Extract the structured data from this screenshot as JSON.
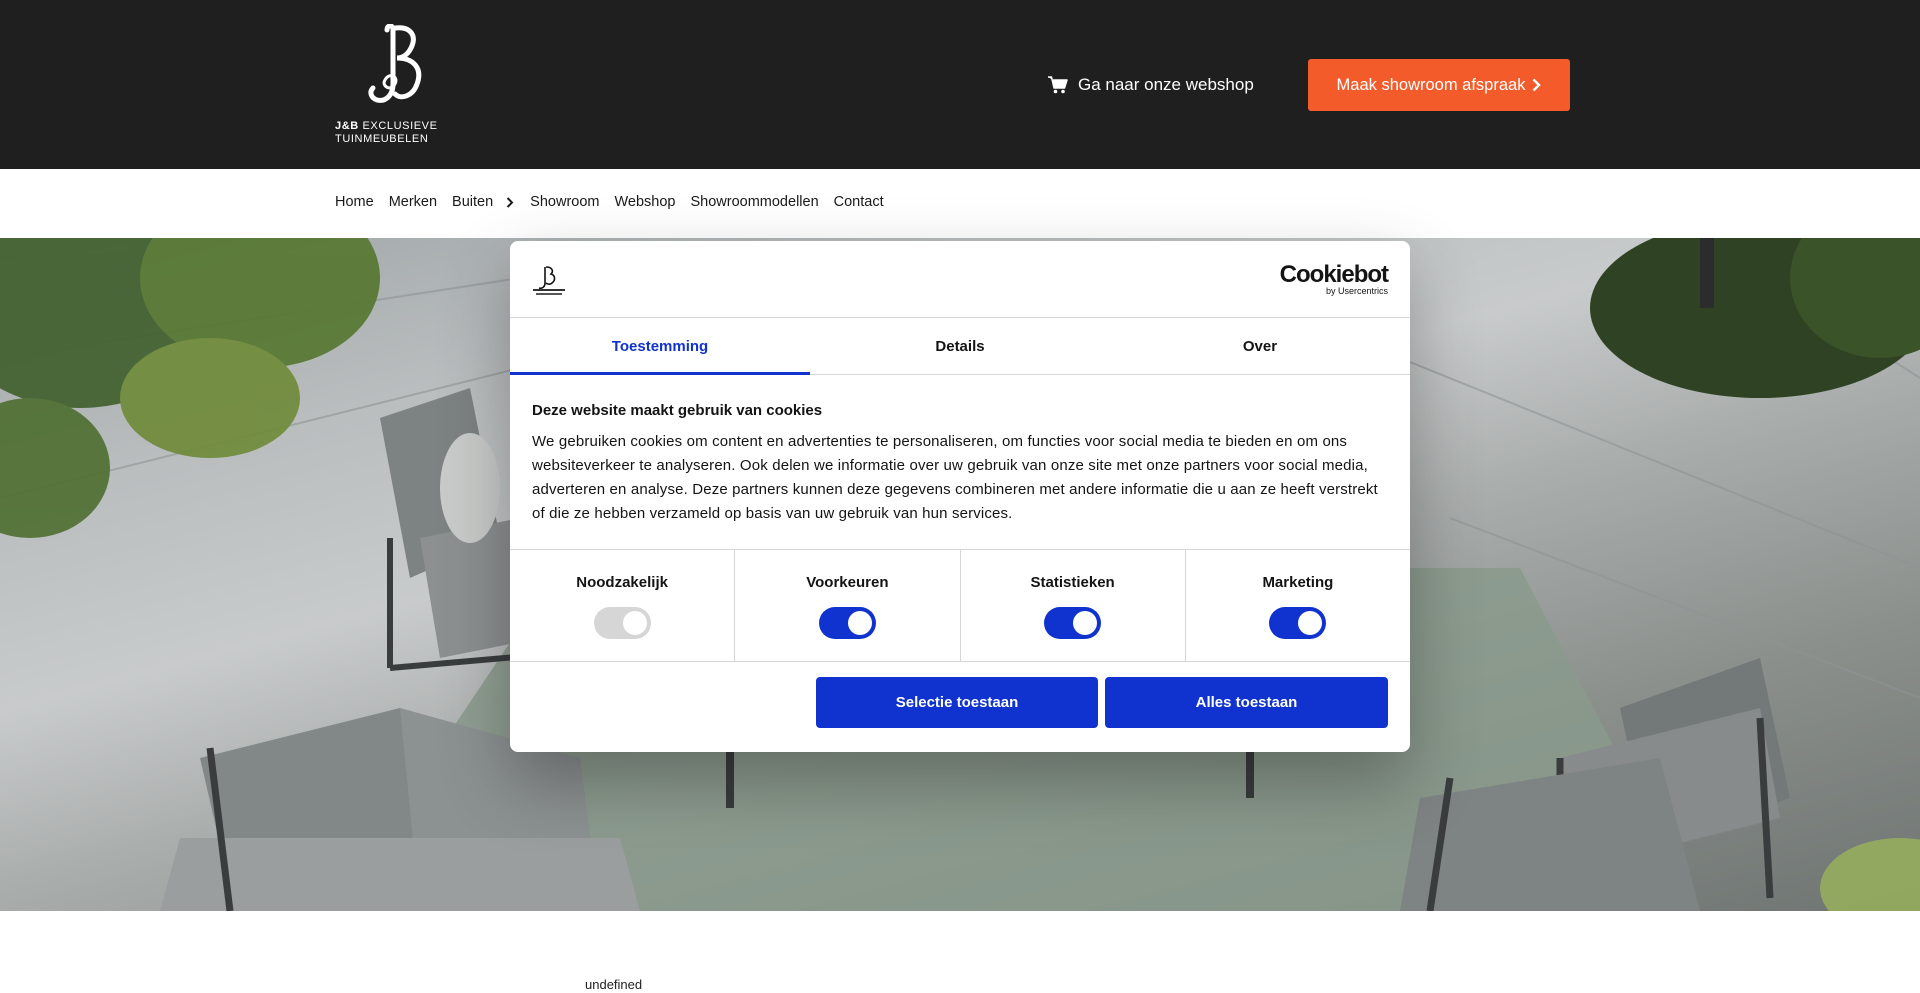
{
  "header": {
    "logo_line1_bold": "J&B",
    "logo_line1_rest": " EXCLUSIEVE",
    "logo_line2": "TUINMEUBELEN",
    "webshop_label": "Ga naar onze webshop",
    "cta_label": "Maak showroom afspraak",
    "cta_color": "#f35b2a",
    "background": "#1f1f1f"
  },
  "nav": {
    "items": [
      "Home",
      "Merken",
      "Buiten",
      "Showroom",
      "Webshop",
      "Showroommodellen",
      "Contact"
    ]
  },
  "page": {
    "footer_text": "undefined"
  },
  "cookie_dialog": {
    "brand_name": "Cookiebot",
    "brand_sub": "by Usercentrics",
    "tabs": [
      {
        "label": "Toestemming",
        "active": true
      },
      {
        "label": "Details",
        "active": false
      },
      {
        "label": "Over",
        "active": false
      }
    ],
    "title": "Deze website maakt gebruik van cookies",
    "body": "We gebruiken cookies om content en advertenties te personaliseren, om functies voor social media te bieden en om ons websiteverkeer te analyseren. Ook delen we informatie over uw gebruik van onze site met onze partners voor social media, adverteren en analyse. Deze partners kunnen deze gegevens combineren met andere informatie die u aan ze heeft verstrekt of die ze hebben verzameld op basis van uw gebruik van hun services.",
    "toggles": [
      {
        "label": "Noodzakelijk",
        "on": true,
        "disabled": true
      },
      {
        "label": "Voorkeuren",
        "on": true,
        "disabled": false
      },
      {
        "label": "Statistieken",
        "on": true,
        "disabled": false
      },
      {
        "label": "Marketing",
        "on": true,
        "disabled": false
      }
    ],
    "buttons": {
      "selection": "Selectie toestaan",
      "all": "Alles toestaan"
    },
    "accent_color": "#1032cf"
  }
}
